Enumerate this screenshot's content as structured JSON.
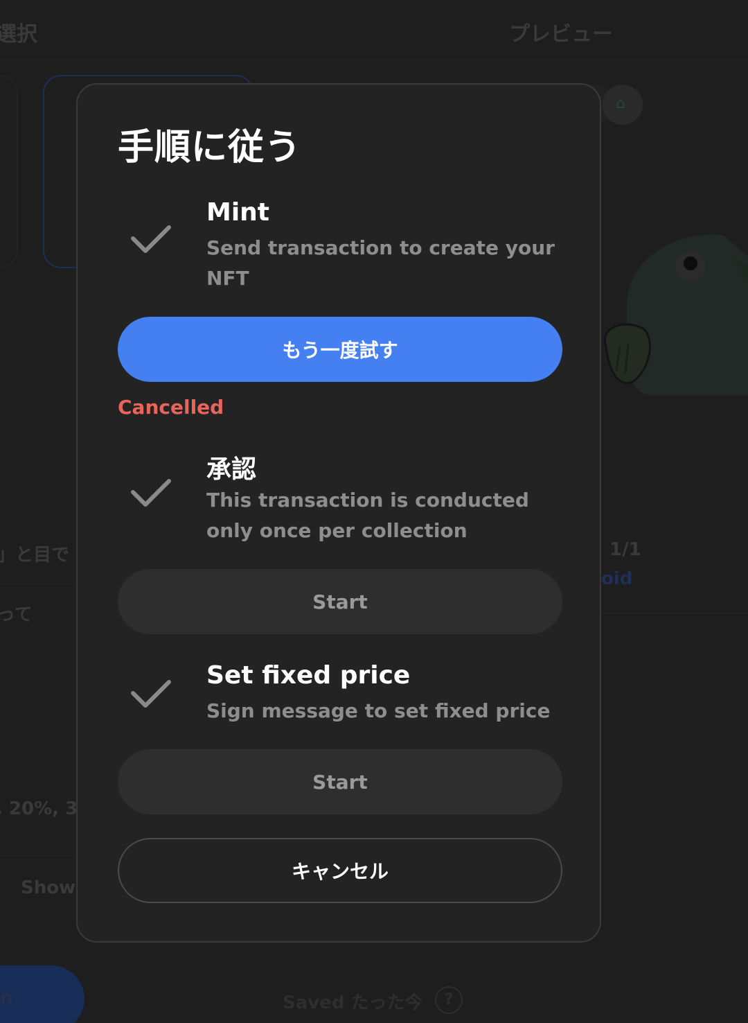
{
  "background": {
    "left_heading": "選択",
    "right_heading": "プレビュー",
    "left_snippet_1": "」と目で",
    "left_snippet_2": "って",
    "left_snippet_3": ", 20%, 30",
    "left_snippet_4": "Show",
    "right_snippet_1": "1/1",
    "right_snippet_2": "oid",
    "blue_button_fragment": "n",
    "saved_text": "Saved たった今",
    "help_icon_glyph": "?"
  },
  "modal": {
    "title": "手順に従う",
    "steps": [
      {
        "title": "Mint",
        "description": "Send transaction to create your NFT",
        "check_icon": "checkmark-icon",
        "button_label": "もう一度試す",
        "status": "Cancelled"
      },
      {
        "title": "承認",
        "description": "This transaction is conducted only once per collection",
        "check_icon": "checkmark-icon",
        "button_label": "Start"
      },
      {
        "title": "Set fixed price",
        "description": "Sign message to set fixed price",
        "check_icon": "checkmark-icon",
        "button_label": "Start"
      }
    ],
    "cancel_label": "キャンセル"
  },
  "colors": {
    "primary": "#4580f2",
    "cancelled": "#e8655c",
    "modal_bg": "#232323",
    "check": "#8a8a8a"
  }
}
